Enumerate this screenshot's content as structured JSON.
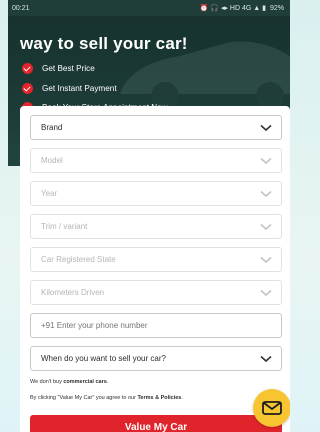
{
  "status_bar": {
    "time": "00:21",
    "indicators": "⏰ 🎧 ◂▸ HD 4G ▲ ▮",
    "battery": "92%"
  },
  "hero": {
    "title": "way to sell your car!",
    "benefits": [
      "Get Best Price",
      "Get Instant Payment",
      "Book Your Store Appointment Now"
    ]
  },
  "form": {
    "brand_label": "Brand",
    "model_label": "Model",
    "year_label": "Year",
    "trim_label": "Trim / variant",
    "state_label": "Car Registered State",
    "km_label": "Kilometers Driven",
    "phone_placeholder": "+91 Enter your phone number",
    "sell_when_label": "When do you want to sell your car?",
    "note_prefix": "We don't buy ",
    "note_bold": "commercial cars",
    "note_suffix": ".",
    "terms_prefix": "By clicking \"Value My Car\" you agree to our ",
    "terms_bold": "Terms & Policies",
    "terms_suffix": ".",
    "cta_label": "Value My Car"
  },
  "colors": {
    "accent_red": "#e0242c",
    "hero_bg": "#17322f",
    "fab_yellow": "#f7c531"
  }
}
